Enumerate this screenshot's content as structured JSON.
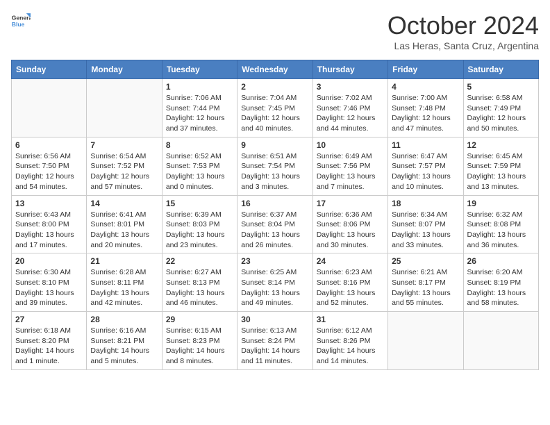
{
  "header": {
    "logo_line1": "General",
    "logo_line2": "Blue",
    "month": "October 2024",
    "location": "Las Heras, Santa Cruz, Argentina"
  },
  "weekdays": [
    "Sunday",
    "Monday",
    "Tuesday",
    "Wednesday",
    "Thursday",
    "Friday",
    "Saturday"
  ],
  "weeks": [
    [
      {
        "day": "",
        "sunrise": "",
        "sunset": "",
        "daylight": ""
      },
      {
        "day": "",
        "sunrise": "",
        "sunset": "",
        "daylight": ""
      },
      {
        "day": "1",
        "sunrise": "Sunrise: 7:06 AM",
        "sunset": "Sunset: 7:44 PM",
        "daylight": "Daylight: 12 hours and 37 minutes."
      },
      {
        "day": "2",
        "sunrise": "Sunrise: 7:04 AM",
        "sunset": "Sunset: 7:45 PM",
        "daylight": "Daylight: 12 hours and 40 minutes."
      },
      {
        "day": "3",
        "sunrise": "Sunrise: 7:02 AM",
        "sunset": "Sunset: 7:46 PM",
        "daylight": "Daylight: 12 hours and 44 minutes."
      },
      {
        "day": "4",
        "sunrise": "Sunrise: 7:00 AM",
        "sunset": "Sunset: 7:48 PM",
        "daylight": "Daylight: 12 hours and 47 minutes."
      },
      {
        "day": "5",
        "sunrise": "Sunrise: 6:58 AM",
        "sunset": "Sunset: 7:49 PM",
        "daylight": "Daylight: 12 hours and 50 minutes."
      }
    ],
    [
      {
        "day": "6",
        "sunrise": "Sunrise: 6:56 AM",
        "sunset": "Sunset: 7:50 PM",
        "daylight": "Daylight: 12 hours and 54 minutes."
      },
      {
        "day": "7",
        "sunrise": "Sunrise: 6:54 AM",
        "sunset": "Sunset: 7:52 PM",
        "daylight": "Daylight: 12 hours and 57 minutes."
      },
      {
        "day": "8",
        "sunrise": "Sunrise: 6:52 AM",
        "sunset": "Sunset: 7:53 PM",
        "daylight": "Daylight: 13 hours and 0 minutes."
      },
      {
        "day": "9",
        "sunrise": "Sunrise: 6:51 AM",
        "sunset": "Sunset: 7:54 PM",
        "daylight": "Daylight: 13 hours and 3 minutes."
      },
      {
        "day": "10",
        "sunrise": "Sunrise: 6:49 AM",
        "sunset": "Sunset: 7:56 PM",
        "daylight": "Daylight: 13 hours and 7 minutes."
      },
      {
        "day": "11",
        "sunrise": "Sunrise: 6:47 AM",
        "sunset": "Sunset: 7:57 PM",
        "daylight": "Daylight: 13 hours and 10 minutes."
      },
      {
        "day": "12",
        "sunrise": "Sunrise: 6:45 AM",
        "sunset": "Sunset: 7:59 PM",
        "daylight": "Daylight: 13 hours and 13 minutes."
      }
    ],
    [
      {
        "day": "13",
        "sunrise": "Sunrise: 6:43 AM",
        "sunset": "Sunset: 8:00 PM",
        "daylight": "Daylight: 13 hours and 17 minutes."
      },
      {
        "day": "14",
        "sunrise": "Sunrise: 6:41 AM",
        "sunset": "Sunset: 8:01 PM",
        "daylight": "Daylight: 13 hours and 20 minutes."
      },
      {
        "day": "15",
        "sunrise": "Sunrise: 6:39 AM",
        "sunset": "Sunset: 8:03 PM",
        "daylight": "Daylight: 13 hours and 23 minutes."
      },
      {
        "day": "16",
        "sunrise": "Sunrise: 6:37 AM",
        "sunset": "Sunset: 8:04 PM",
        "daylight": "Daylight: 13 hours and 26 minutes."
      },
      {
        "day": "17",
        "sunrise": "Sunrise: 6:36 AM",
        "sunset": "Sunset: 8:06 PM",
        "daylight": "Daylight: 13 hours and 30 minutes."
      },
      {
        "day": "18",
        "sunrise": "Sunrise: 6:34 AM",
        "sunset": "Sunset: 8:07 PM",
        "daylight": "Daylight: 13 hours and 33 minutes."
      },
      {
        "day": "19",
        "sunrise": "Sunrise: 6:32 AM",
        "sunset": "Sunset: 8:08 PM",
        "daylight": "Daylight: 13 hours and 36 minutes."
      }
    ],
    [
      {
        "day": "20",
        "sunrise": "Sunrise: 6:30 AM",
        "sunset": "Sunset: 8:10 PM",
        "daylight": "Daylight: 13 hours and 39 minutes."
      },
      {
        "day": "21",
        "sunrise": "Sunrise: 6:28 AM",
        "sunset": "Sunset: 8:11 PM",
        "daylight": "Daylight: 13 hours and 42 minutes."
      },
      {
        "day": "22",
        "sunrise": "Sunrise: 6:27 AM",
        "sunset": "Sunset: 8:13 PM",
        "daylight": "Daylight: 13 hours and 46 minutes."
      },
      {
        "day": "23",
        "sunrise": "Sunrise: 6:25 AM",
        "sunset": "Sunset: 8:14 PM",
        "daylight": "Daylight: 13 hours and 49 minutes."
      },
      {
        "day": "24",
        "sunrise": "Sunrise: 6:23 AM",
        "sunset": "Sunset: 8:16 PM",
        "daylight": "Daylight: 13 hours and 52 minutes."
      },
      {
        "day": "25",
        "sunrise": "Sunrise: 6:21 AM",
        "sunset": "Sunset: 8:17 PM",
        "daylight": "Daylight: 13 hours and 55 minutes."
      },
      {
        "day": "26",
        "sunrise": "Sunrise: 6:20 AM",
        "sunset": "Sunset: 8:19 PM",
        "daylight": "Daylight: 13 hours and 58 minutes."
      }
    ],
    [
      {
        "day": "27",
        "sunrise": "Sunrise: 6:18 AM",
        "sunset": "Sunset: 8:20 PM",
        "daylight": "Daylight: 14 hours and 1 minute."
      },
      {
        "day": "28",
        "sunrise": "Sunrise: 6:16 AM",
        "sunset": "Sunset: 8:21 PM",
        "daylight": "Daylight: 14 hours and 5 minutes."
      },
      {
        "day": "29",
        "sunrise": "Sunrise: 6:15 AM",
        "sunset": "Sunset: 8:23 PM",
        "daylight": "Daylight: 14 hours and 8 minutes."
      },
      {
        "day": "30",
        "sunrise": "Sunrise: 6:13 AM",
        "sunset": "Sunset: 8:24 PM",
        "daylight": "Daylight: 14 hours and 11 minutes."
      },
      {
        "day": "31",
        "sunrise": "Sunrise: 6:12 AM",
        "sunset": "Sunset: 8:26 PM",
        "daylight": "Daylight: 14 hours and 14 minutes."
      },
      {
        "day": "",
        "sunrise": "",
        "sunset": "",
        "daylight": ""
      },
      {
        "day": "",
        "sunrise": "",
        "sunset": "",
        "daylight": ""
      }
    ]
  ]
}
